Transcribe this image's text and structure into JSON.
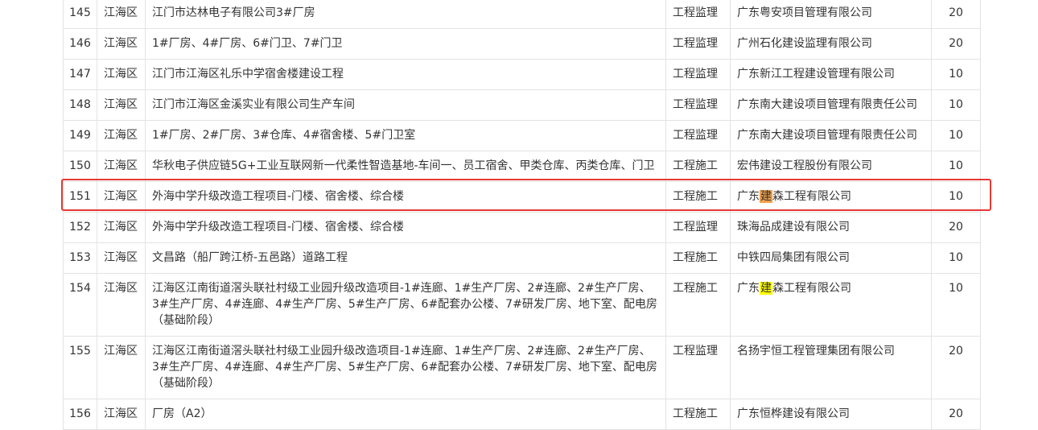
{
  "rows": [
    {
      "no": "145",
      "district": "江海区",
      "project": "江门市达林电子有限公司3#厂房",
      "type": "工程监理",
      "company": "广东粤安项目管理有限公司",
      "score": "20"
    },
    {
      "no": "146",
      "district": "江海区",
      "project": "1#厂房、4#厂房、6#门卫、7#门卫",
      "type": "工程监理",
      "company": "广州石化建设监理有限公司",
      "score": "20"
    },
    {
      "no": "147",
      "district": "江海区",
      "project": "江门市江海区礼乐中学宿舍楼建设工程",
      "type": "工程监理",
      "company": "广东新江工程建设管理有限公司",
      "score": "10"
    },
    {
      "no": "148",
      "district": "江海区",
      "project": "江门市江海区金溪实业有限公司生产车间",
      "type": "工程监理",
      "company": "广东南大建设项目管理有限责任公司",
      "score": "10"
    },
    {
      "no": "149",
      "district": "江海区",
      "project": "1#厂房、2#厂房、3#仓库、4#宿舍楼、5#门卫室",
      "type": "工程监理",
      "company": "广东南大建设项目管理有限责任公司",
      "score": "10"
    },
    {
      "no": "150",
      "district": "江海区",
      "project": "华秋电子供应链5G+工业互联网新一代柔性智造基地-车间一、员工宿舍、甲类仓库、丙类仓库、门卫",
      "type": "工程施工",
      "company": "宏伟建设工程股份有限公司",
      "score": "10"
    },
    {
      "no": "151",
      "district": "江海区",
      "project": "外海中学升级改造工程项目-门楼、宿舍楼、综合楼",
      "type": "工程施工",
      "company_pre": "广东",
      "company_hl": "建",
      "company_post": "森工程有限公司",
      "score": "10"
    },
    {
      "no": "152",
      "district": "江海区",
      "project": "外海中学升级改造工程项目-门楼、宿舍楼、综合楼",
      "type": "工程监理",
      "company": "珠海品成建设有限公司",
      "score": "20"
    },
    {
      "no": "153",
      "district": "江海区",
      "project": "文昌路（船厂跨江桥-五邑路）道路工程",
      "type": "工程施工",
      "company": "中铁四局集团有限公司",
      "score": "10"
    },
    {
      "no": "154",
      "district": "江海区",
      "project": "江海区江南街道滘头联社村级工业园升级改造项目-1#连廊、1#生产厂房、2#连廊、2#生产厂房、3#生产厂房、4#连廊、4#生产厂房、5#生产厂房、6#配套办公楼、7#研发厂房、地下室、配电房（基础阶段）",
      "type": "工程施工",
      "company_pre": "广东",
      "company_hl": "建",
      "company_post": "森工程有限公司",
      "score": "10"
    },
    {
      "no": "155",
      "district": "江海区",
      "project": "江海区江南街道滘头联社村级工业园升级改造项目-1#连廊、1#生产厂房、2#连廊、2#生产厂房、3#生产厂房、4#连廊、4#生产厂房、5#生产厂房、6#配套办公楼、7#研发厂房、地下室、配电房（基础阶段）",
      "type": "工程监理",
      "company": "名扬宇恒工程管理集团有限公司",
      "score": "20"
    },
    {
      "no": "156",
      "district": "江海区",
      "project": "厂房（A2）",
      "type": "工程施工",
      "company": "广东恒桦建设有限公司",
      "score": "20"
    }
  ],
  "colors": {
    "highlight_box": "#e53935",
    "search_hit_current": "#f0a04b",
    "search_hit": "#ffff00"
  }
}
